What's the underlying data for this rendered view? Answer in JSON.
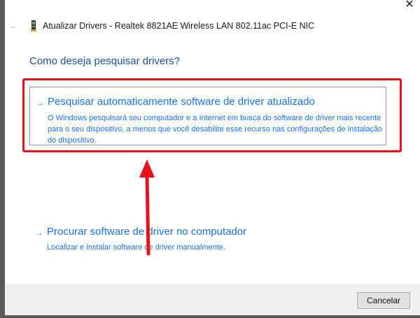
{
  "window": {
    "title": "Atualizar Drivers - Realtek 8821AE Wireless LAN 802.11ac PCI-E NIC",
    "close_glyph": "✕",
    "back_glyph": "←"
  },
  "heading": "Como deseja pesquisar drivers?",
  "options": [
    {
      "arrow": "→",
      "title": "Pesquisar automaticamente software de driver atualizado",
      "description": "O Windows pesquisará seu computador e a Internet em busca do software de driver mais recente para o seu dispositivo, a menos que você desabilite esse recurso nas configurações de instalação do dispositivo."
    },
    {
      "arrow": "→",
      "title": "Procurar software de driver no computador",
      "description": "Localizar e instalar software de driver manualmente."
    }
  ],
  "footer": {
    "cancel_label": "Cancelar"
  },
  "colors": {
    "link": "#1e6fd6",
    "heading": "#1f4e9a",
    "highlight": "#e8101a"
  },
  "icons": [
    "close-icon",
    "back-arrow-icon",
    "network-card-icon",
    "arrow-right-icon"
  ]
}
